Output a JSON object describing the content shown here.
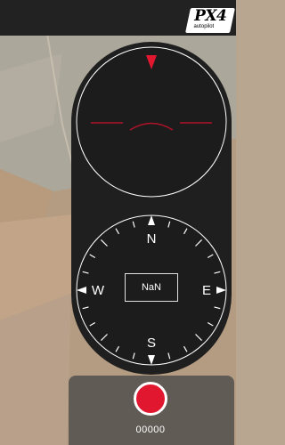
{
  "header": {
    "logo_text": "PX4",
    "logo_subtext": "autopilot"
  },
  "compass": {
    "north": "N",
    "east": "E",
    "south": "S",
    "west": "W",
    "heading_value": "NaN"
  },
  "recording": {
    "counter": "00000"
  },
  "colors": {
    "accent_red": "#e0172f",
    "instrument_bg": "#1f1f1f"
  }
}
